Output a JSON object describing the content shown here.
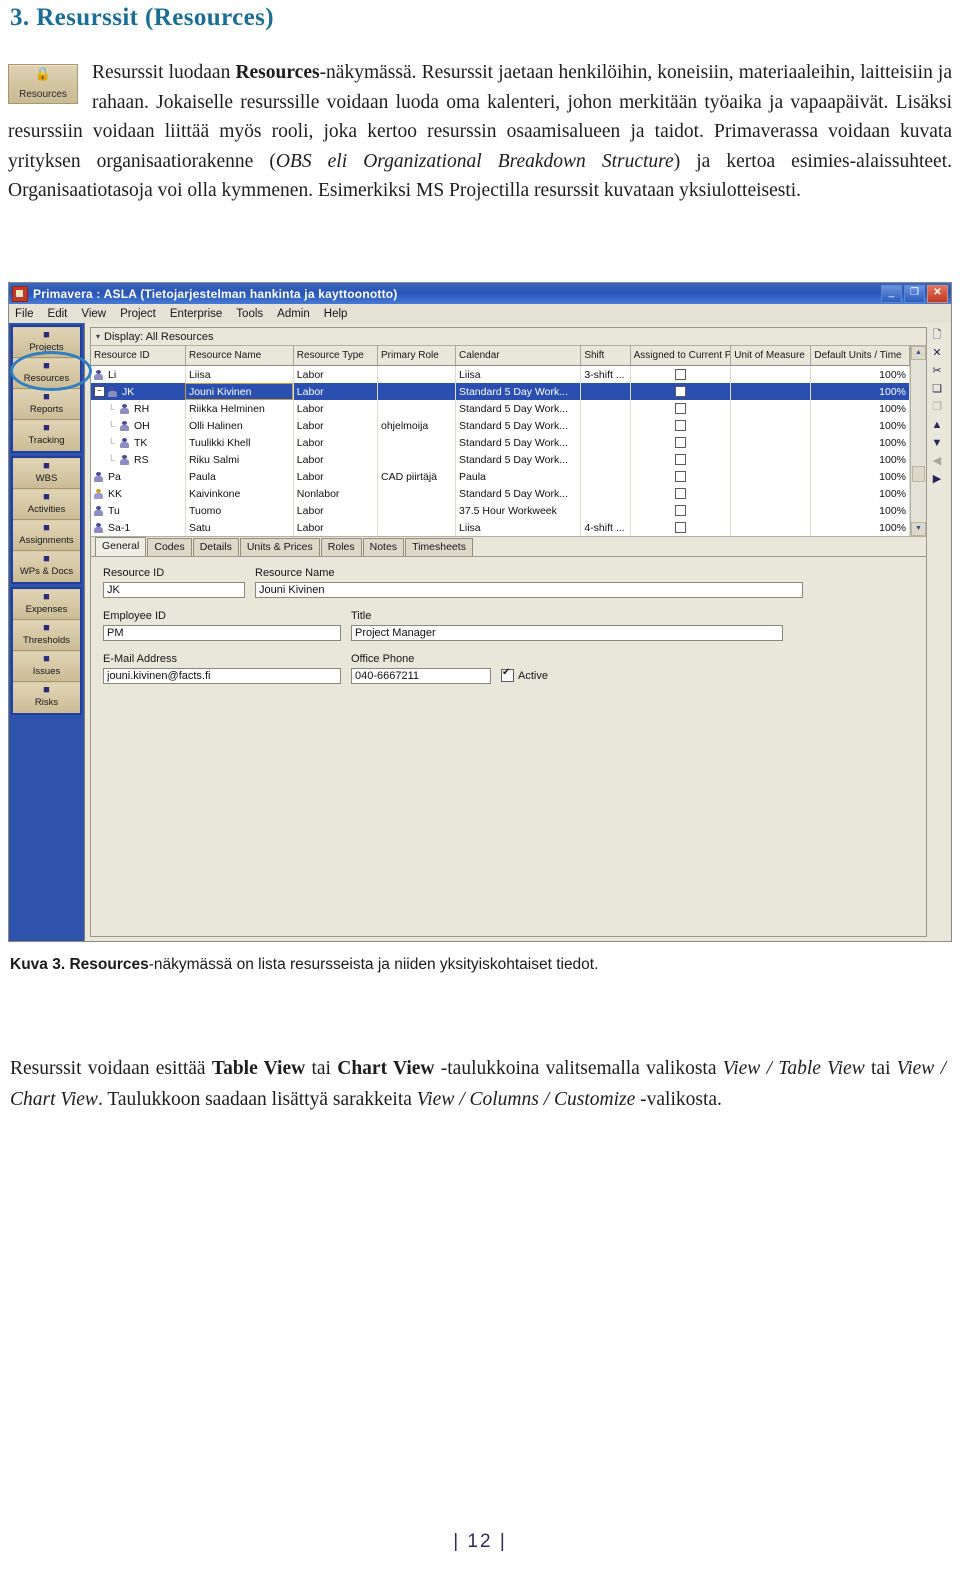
{
  "document": {
    "heading": "3. Resurssit (Resources)",
    "intro_icon": {
      "glyph": "person-lock-icon",
      "caption": "Resources"
    },
    "intro_paragraph": {
      "segments": [
        {
          "text": "Resurssit luodaan ",
          "style": "normal"
        },
        {
          "text": "Resources",
          "style": "bold"
        },
        {
          "text": "-näkymässä. Resurssit jaetaan henkilöihin, koneisiin, materiaaleihin, laitteisiin ja rahaan.  Jokaiselle resurssille voidaan luoda oma kalenteri, johon merkitään työaika ja vapaapäivät. Lisäksi resurssiin voidaan liittää myös rooli, joka kertoo resurssin osaamisalueen ja taidot. Primaverassa voidaan kuvata yrityksen organisaatiorakenne (",
          "style": "normal"
        },
        {
          "text": "OBS eli Organizational Breakdown Structure",
          "style": "italic"
        },
        {
          "text": ") ja kertoa esimies-alaissuhteet. Organisaatiotasoja voi olla kymmenen. Esimerkiksi MS Projectilla resurssit kuvataan yksiulotteisesti.",
          "style": "normal"
        }
      ]
    },
    "figure_caption": {
      "segments": [
        {
          "text": "Kuva 3. ",
          "style": "bold"
        },
        {
          "text": "Resources",
          "style": "bold"
        },
        {
          "text": "-näkymässä on lista resursseista ja niiden yksityiskohtaiset tiedot.",
          "style": "normal"
        }
      ]
    },
    "closing_paragraph": {
      "segments": [
        {
          "text": "Resurssit voidaan esittää ",
          "style": "normal"
        },
        {
          "text": "Table View",
          "style": "bold"
        },
        {
          "text": " tai ",
          "style": "normal"
        },
        {
          "text": "Chart View",
          "style": "bold"
        },
        {
          "text": " -taulukkoina valitsemalla valikosta ",
          "style": "normal"
        },
        {
          "text": "View / Table View",
          "style": "italic"
        },
        {
          "text": "  tai ",
          "style": "normal"
        },
        {
          "text": "View / Chart View",
          "style": "italic"
        },
        {
          "text": ". Taulukkoon saadaan lisättyä sarakkeita ",
          "style": "normal"
        },
        {
          "text": "View / Columns / Customize",
          "style": "italic"
        },
        {
          "text": " -valikosta.",
          "style": "normal"
        }
      ]
    },
    "page_number": "| 12 |",
    "heading_color": "#1b6e93"
  },
  "app": {
    "title": "Primavera : ASLA (Tietojarjestelman hankinta ja kayttoonotto)",
    "app_icon": "primavera-icon",
    "window_controls": [
      {
        "name": "minimize",
        "glyph": "_"
      },
      {
        "name": "restore",
        "glyph": "❐"
      },
      {
        "name": "close",
        "glyph": "✕"
      }
    ],
    "menu": [
      "File",
      "Edit",
      "View",
      "Project",
      "Enterprise",
      "Tools",
      "Admin",
      "Help"
    ],
    "sidebar": {
      "groups": [
        {
          "items": [
            {
              "label": "Projects",
              "icon": "projects-icon",
              "selected": false
            },
            {
              "label": "Resources",
              "icon": "resources-icon",
              "selected": true
            },
            {
              "label": "Reports",
              "icon": "reports-icon",
              "selected": false
            },
            {
              "label": "Tracking",
              "icon": "tracking-icon",
              "selected": false
            }
          ]
        },
        {
          "items": [
            {
              "label": "WBS",
              "icon": "wbs-icon",
              "selected": false
            },
            {
              "label": "Activities",
              "icon": "activities-icon",
              "selected": false
            },
            {
              "label": "Assignments",
              "icon": "assignments-icon",
              "selected": false
            },
            {
              "label": "WPs & Docs",
              "icon": "documents-icon",
              "selected": false
            }
          ]
        },
        {
          "items": [
            {
              "label": "Expenses",
              "icon": "expenses-icon",
              "selected": false
            },
            {
              "label": "Thresholds",
              "icon": "thresholds-icon",
              "selected": false
            },
            {
              "label": "Issues",
              "icon": "issues-icon",
              "selected": false
            },
            {
              "label": "Risks",
              "icon": "risks-icon",
              "selected": false
            }
          ]
        }
      ]
    },
    "display_bar": {
      "caret": "▾",
      "label": "Display: All Resources"
    },
    "grid": {
      "columns": [
        "Resource ID",
        "Resource Name",
        "Resource Type",
        "Primary Role",
        "Calendar",
        "Shift",
        "Assigned to Current Project",
        "Unit of Measure",
        "Default Units / Time"
      ],
      "rows": [
        {
          "id": "Li",
          "name": "Liisa",
          "type": "Labor",
          "role": "",
          "calendar": "Liisa",
          "shift": "3-shift ...",
          "assigned": false,
          "uom": "",
          "units": "100%",
          "indent": 0,
          "expander": "",
          "icon": "group-icon",
          "selected": false
        },
        {
          "id": "JK",
          "name": "Jouni Kivinen",
          "type": "Labor",
          "role": "",
          "calendar": "Standard 5 Day Work...",
          "shift": "",
          "assigned": false,
          "uom": "",
          "units": "100%",
          "indent": 0,
          "expander": "−",
          "icon": "person-icon",
          "selected": true
        },
        {
          "id": "RH",
          "name": "Riikka Helminen",
          "type": "Labor",
          "role": "",
          "calendar": "Standard 5 Day Work...",
          "shift": "",
          "assigned": false,
          "uom": "",
          "units": "100%",
          "indent": 1,
          "expander": "",
          "icon": "person-icon",
          "selected": false
        },
        {
          "id": "OH",
          "name": "Olli Halinen",
          "type": "Labor",
          "role": "ohjelmoija",
          "calendar": "Standard 5 Day Work...",
          "shift": "",
          "assigned": false,
          "uom": "",
          "units": "100%",
          "indent": 1,
          "expander": "",
          "icon": "person-icon",
          "selected": false
        },
        {
          "id": "TK",
          "name": "Tuulikki Khell",
          "type": "Labor",
          "role": "",
          "calendar": "Standard 5 Day Work...",
          "shift": "",
          "assigned": false,
          "uom": "",
          "units": "100%",
          "indent": 1,
          "expander": "",
          "icon": "person-icon",
          "selected": false
        },
        {
          "id": "RS",
          "name": "Riku Salmi",
          "type": "Labor",
          "role": "",
          "calendar": "Standard 5 Day Work...",
          "shift": "",
          "assigned": false,
          "uom": "",
          "units": "100%",
          "indent": 1,
          "expander": "",
          "icon": "person-icon",
          "selected": false
        },
        {
          "id": "Pa",
          "name": "Paula",
          "type": "Labor",
          "role": "CAD piirtäjä",
          "calendar": "Paula",
          "shift": "",
          "assigned": false,
          "uom": "",
          "units": "100%",
          "indent": 0,
          "expander": "",
          "icon": "group-icon",
          "selected": false
        },
        {
          "id": "KK",
          "name": "Kaivinkone",
          "type": "Nonlabor",
          "role": "",
          "calendar": "Standard 5 Day Work...",
          "shift": "",
          "assigned": false,
          "uom": "",
          "units": "100%",
          "indent": 0,
          "expander": "",
          "icon": "machine-icon",
          "selected": false
        },
        {
          "id": "Tu",
          "name": "Tuomo",
          "type": "Labor",
          "role": "",
          "calendar": "37.5 Hour Workweek",
          "shift": "",
          "assigned": false,
          "uom": "",
          "units": "100%",
          "indent": 0,
          "expander": "",
          "icon": "group-icon",
          "selected": false
        },
        {
          "id": "Sa-1",
          "name": "Satu",
          "type": "Labor",
          "role": "",
          "calendar": "Liisa",
          "shift": "4-shift ...",
          "assigned": false,
          "uom": "",
          "units": "100%",
          "indent": 0,
          "expander": "",
          "icon": "person-icon",
          "selected": false
        }
      ],
      "scrollbar": {
        "up": "▲",
        "down": "▼"
      }
    },
    "tabs": [
      {
        "label": "General",
        "active": true
      },
      {
        "label": "Codes",
        "active": false
      },
      {
        "label": "Details",
        "active": false
      },
      {
        "label": "Units & Prices",
        "active": false
      },
      {
        "label": "Roles",
        "active": false
      },
      {
        "label": "Notes",
        "active": false
      },
      {
        "label": "Timesheets",
        "active": false
      }
    ],
    "form": {
      "resource_id": {
        "label": "Resource ID",
        "value": "JK"
      },
      "resource_name": {
        "label": "Resource Name",
        "value": "Jouni Kivinen"
      },
      "employee_id": {
        "label": "Employee ID",
        "value": "PM"
      },
      "title": {
        "label": "Title",
        "value": "Project Manager"
      },
      "email": {
        "label": "E-Mail Address",
        "value": "jouni.kivinen@facts.fi"
      },
      "office_phone": {
        "label": "Office Phone",
        "value": "040-6667211"
      },
      "active": {
        "label": "Active",
        "checked": true
      }
    },
    "right_rail": [
      {
        "name": "new-icon",
        "glyph": "🗋",
        "dim": false
      },
      {
        "name": "delete-icon",
        "glyph": "✕",
        "dim": false
      },
      {
        "name": "cut-icon",
        "glyph": "✂",
        "dim": false
      },
      {
        "name": "copy-icon",
        "glyph": "❏",
        "dim": false
      },
      {
        "name": "paste-icon",
        "glyph": "❐",
        "dim": true
      },
      {
        "name": "move-up-icon",
        "glyph": "▲",
        "dim": false
      },
      {
        "name": "move-down-icon",
        "glyph": "▼",
        "dim": false
      },
      {
        "name": "outdent-icon",
        "glyph": "◀",
        "dim": true
      },
      {
        "name": "indent-icon",
        "glyph": "▶",
        "dim": false
      }
    ]
  }
}
